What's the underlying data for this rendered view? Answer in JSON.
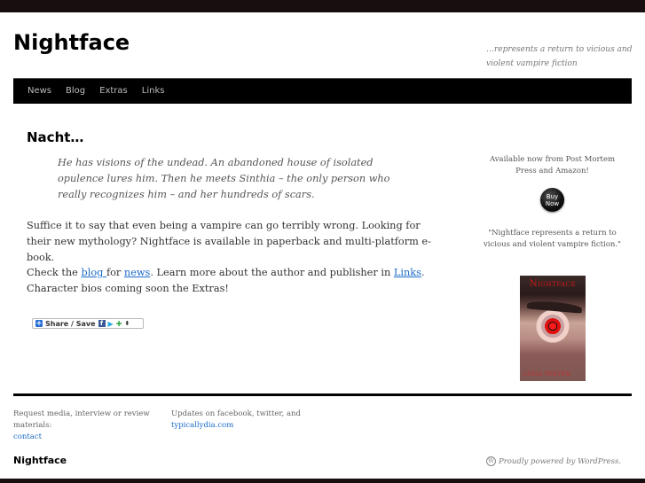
{
  "site": {
    "title": "Nightface",
    "description": "…represents a return to vicious and violent vampire fiction"
  },
  "nav": {
    "items": [
      {
        "label": "News"
      },
      {
        "label": "Blog"
      },
      {
        "label": "Extras"
      },
      {
        "label": "Links"
      }
    ]
  },
  "post": {
    "title": "Nacht…",
    "blockquote": "He has visions of the undead. An abandoned house of isolated opulence lures him. Then he meets Sinthia – the only person who really recognizes him – and her hundreds of scars.",
    "para1": "Suffice it to say that even being a vampire can go terribly wrong. Looking for their new mythology? Nightface is available in paperback and multi-platform e-book.",
    "para2": {
      "t1": "Check the ",
      "link_blog": "blog ",
      "t2": "for ",
      "link_news": "news",
      "t3": ". Learn more about the author and publisher in ",
      "link_links": "Links",
      "t4": ". Character bios coming soon the Extras!"
    },
    "share": {
      "label": "Share / Save",
      "plus_icon": "+",
      "facebook_icon": "f",
      "twitter_icon": "🐦",
      "google_icon": "➰",
      "more_icon": "⬍"
    }
  },
  "sidebar": {
    "available_text": "Available now from Post Mortem Press and Amazon!",
    "buy_now": "Buy Now",
    "quote": "\"Nightface represents a return to vicious and violent vampire fiction.\"",
    "book": {
      "title": "Nightface",
      "author": "Lydia Peever"
    }
  },
  "footer": {
    "col1_text": "Request media, interview or review materials:",
    "col1_link": "contact",
    "col2_text": "Updates on facebook, twitter, and",
    "col2_link": "typicallydia.com",
    "site_title": "Nightface",
    "powered_by": "Proudly powered by WordPress.",
    "wp_icon": "W"
  }
}
